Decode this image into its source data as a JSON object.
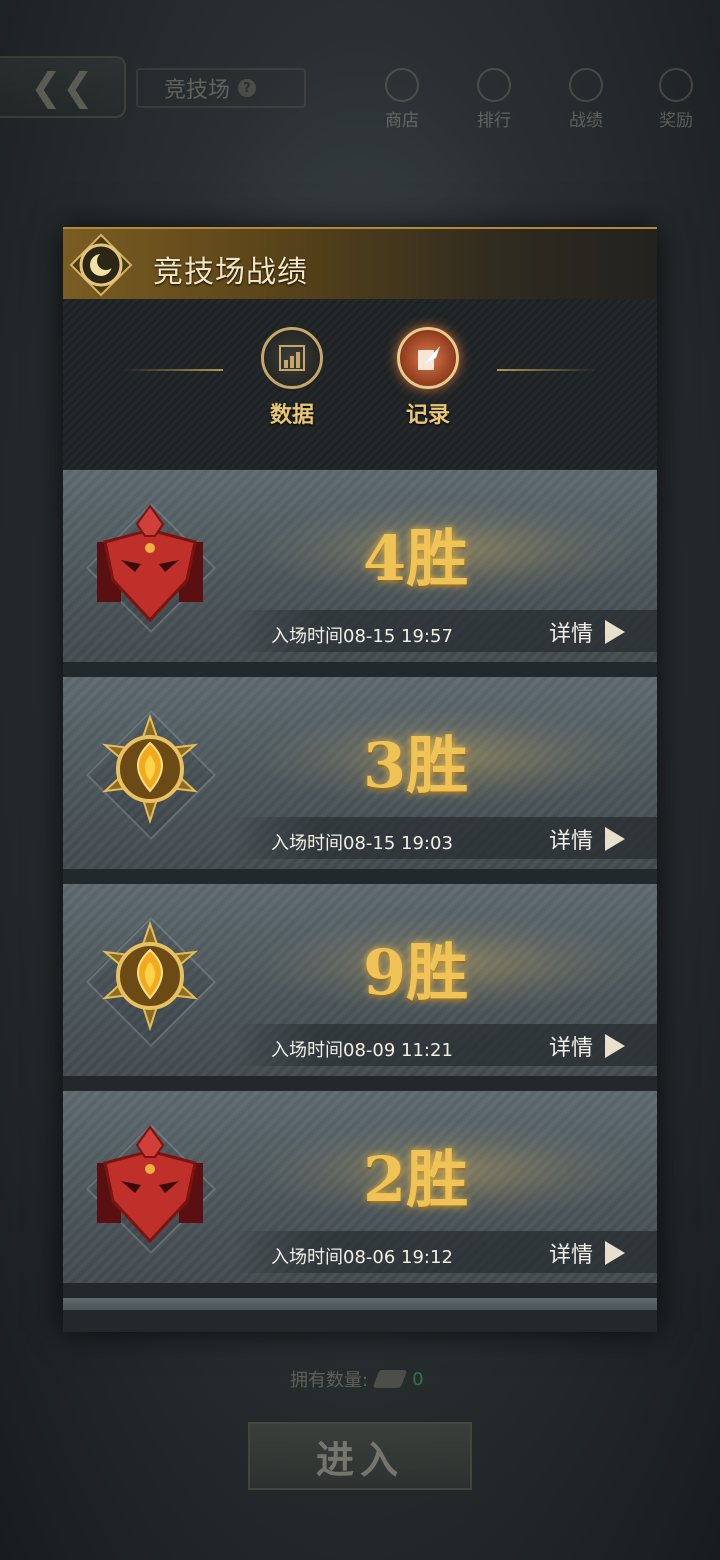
{
  "background": {
    "arena_title": "竞技场",
    "nav": [
      "商店",
      "排行",
      "战绩",
      "奖励"
    ],
    "owned_label": "拥有数量:",
    "owned_count": "0",
    "enter_label": "进入"
  },
  "panel": {
    "title": "竞技场战绩",
    "tabs": [
      {
        "label": "数据",
        "icon": "chart-icon",
        "active": false
      },
      {
        "label": "记录",
        "icon": "quill-icon",
        "active": true
      }
    ]
  },
  "records": [
    {
      "wins": "4胜",
      "time": "入场时间08-15 19:57",
      "detail": "详情",
      "badge": "red-mask-badge"
    },
    {
      "wins": "3胜",
      "time": "入场时间08-15 19:03",
      "detail": "详情",
      "badge": "gold-crest-badge"
    },
    {
      "wins": "9胜",
      "time": "入场时间08-09 11:21",
      "detail": "详情",
      "badge": "gold-crest-badge"
    },
    {
      "wins": "2胜",
      "time": "入场时间08-06 19:12",
      "detail": "详情",
      "badge": "red-mask-badge"
    }
  ],
  "colors": {
    "gold": "#f0c357",
    "accent_red": "#c0302a",
    "panel_bg": "#23282a"
  }
}
